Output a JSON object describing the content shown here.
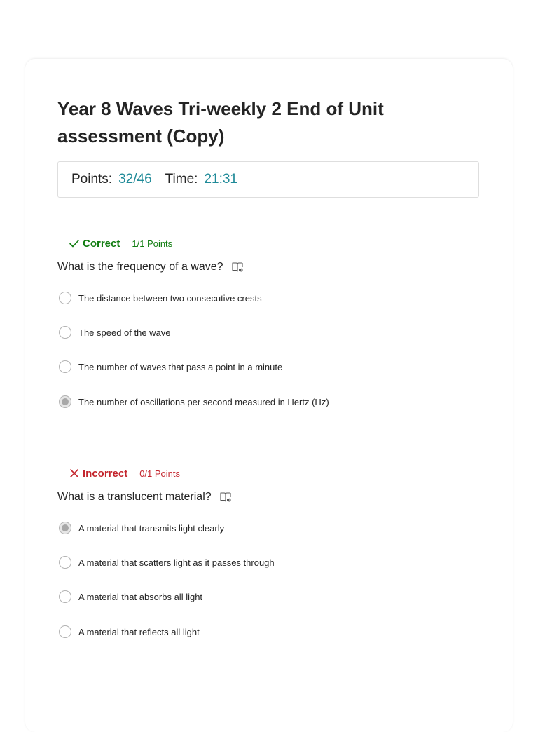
{
  "quiz": {
    "title": "Year 8 Waves Tri-weekly 2 End of Unit assessment (Copy)",
    "points_label": "Points:",
    "points_value": "32/46",
    "time_label": "Time:",
    "time_value": "21:31"
  },
  "questions": [
    {
      "status": "Correct",
      "points": "1/1 Points",
      "text": "What is the frequency of a wave?",
      "options": [
        "The distance between two consecutive crests",
        "The speed of the wave",
        "The number of waves that pass a point in a minute",
        "The number of oscillations per second measured in Hertz (Hz)"
      ],
      "selected_index": 3
    },
    {
      "status": "Incorrect",
      "points": "0/1 Points",
      "text": "What is a translucent material?",
      "options": [
        "A material that transmits light clearly",
        "A material that scatters light as it passes through",
        "A material that absorbs all light",
        "A material that reflects all light"
      ],
      "selected_index": 0
    }
  ],
  "icons": {
    "correct": "checkmark-icon",
    "incorrect": "cross-icon",
    "reader": "immersive-reader-icon"
  },
  "colors": {
    "correct": "#107c10",
    "incorrect": "#c4262e",
    "accent": "#1f8a98"
  }
}
